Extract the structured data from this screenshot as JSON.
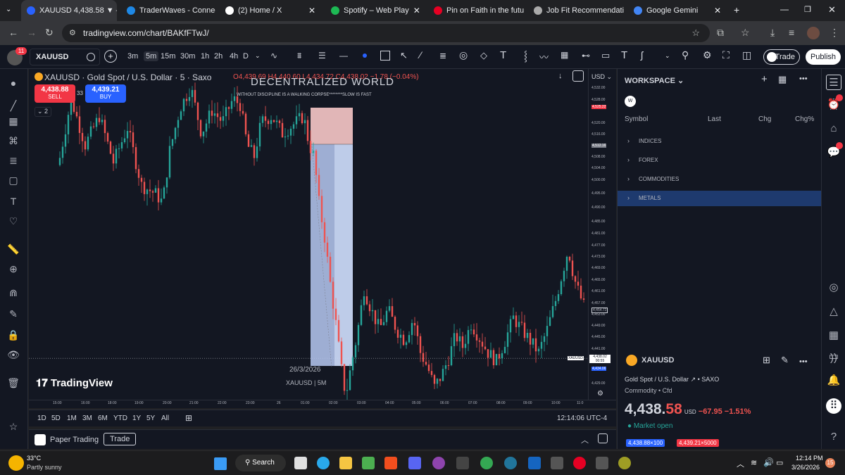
{
  "browser": {
    "tabs": [
      {
        "label": "XAUUSD 4,438.58 ▼ –",
        "icon_color": "#2962ff",
        "active": true
      },
      {
        "label": "TraderWaves - Connec",
        "icon_color": "#1e88e5",
        "active": false
      },
      {
        "label": "(2) Home / X",
        "icon_color": "#ffffff",
        "active": false
      },
      {
        "label": "Spotify – Web Play",
        "icon_color": "#1db954",
        "active": false
      },
      {
        "label": "Pin on Faith in the futu",
        "icon_color": "#e60023",
        "active": false
      },
      {
        "label": "Job Fit Recommendati",
        "icon_color": "#aaaaaa",
        "active": false
      },
      {
        "label": "Google Gemini",
        "icon_color": "#4285f4",
        "active": false
      }
    ],
    "url": "tradingview.com/chart/BAKfFTwJ/"
  },
  "toolbar": {
    "symbol": "XAUUSD",
    "timeframes": [
      "3m",
      "5m",
      "15m",
      "30m",
      "1h",
      "2h",
      "4h",
      "D"
    ],
    "selected_timeframe": "5m",
    "trade_label": "Trade",
    "publish_label": "Publish",
    "alert_badge": "11"
  },
  "chart": {
    "title": "XAUUSD · Gold Spot / U.S. Dollar · 5 · Saxo",
    "ohlc": "O4,439.69 H4,440.60 L4,434.72 C4,438.02 −1.78 (−0.04%)",
    "sell_price": "4,438.88",
    "sell_label": "SELL",
    "buy_price": "4,439.21",
    "buy_label": "BUY",
    "spread": "33",
    "indicator_count": "2",
    "watermark_title": "DECENTRALIZED WORLD",
    "watermark_sub": "WITHOUT DISCIPLINE IS A WALKING CORPSE********SLOW IS FAST",
    "date_stamp": "26/3/2026",
    "symbol_stamp": "XAUUSD | 5M",
    "brand": "TradingView",
    "currency": "USD",
    "price_labels": [
      "4,532.00",
      "4,528.00",
      "4,525.22",
      "4,520.00",
      "4,516.00",
      "4,512.16",
      "4,508.00",
      "4,504.00",
      "4,500.00",
      "4,495.00",
      "4,490.00",
      "4,485.00",
      "4,481.00",
      "4,477.00",
      "4,473.00",
      "4,469.00",
      "4,465.00",
      "4,461.00",
      "4,457.00",
      "4,454.72",
      "4,453.00",
      "4,449.00",
      "4,445.00",
      "4,441.00",
      "4,438.02",
      "4,434.06",
      "4,429.00"
    ],
    "current_price_tag": "4,438.02",
    "current_countdown": "00:55",
    "current_symbol_tag": "XAUUSD",
    "time_labels": [
      "15:00",
      "16:00",
      "18:00",
      "19:00",
      "20:00",
      "21:00",
      "22:00",
      "23:00",
      "26",
      "01:00",
      "02:00",
      "03:00",
      "04:00",
      "05:00",
      "06:00",
      "07:00",
      "08:00",
      "09:00",
      "10:00",
      "11:0"
    ],
    "ranges": [
      "1D",
      "5D",
      "1M",
      "3M",
      "6M",
      "YTD",
      "1Y",
      "5Y",
      "All"
    ],
    "clock": "12:14:06 UTC-4",
    "paper_trading": "Paper Trading",
    "trade_tab": "Trade"
  },
  "watchlist": {
    "workspace": "WORKSPACE",
    "avatar": "W",
    "columns": [
      "Symbol",
      "Last",
      "Chg",
      "Chg%"
    ],
    "groups": [
      "INDICES",
      "FOREX",
      "COMMODITIES",
      "METALS"
    ],
    "selected_group": "METALS"
  },
  "details": {
    "symbol": "XAUUSD",
    "name": "Gold Spot / U.S. Dollar",
    "exchange": "SAXO",
    "type": "Commodity",
    "subtype": "Cfd",
    "price_main": "4,438.",
    "price_small": "58",
    "currency": "USD",
    "change": "−67.95",
    "change_pct": "−1.51%",
    "market_status": "Market open",
    "bid": "4,438.88×100",
    "ask": "4,439.21×5000"
  },
  "taskbar": {
    "weather_temp": "33°C",
    "weather_desc": "Partly sunny",
    "search": "Search",
    "time": "12:14 PM",
    "date": "3/26/2026",
    "notif_count": "15"
  },
  "colors": {
    "up": "#26a69a",
    "down": "#ef5350",
    "accent": "#2962ff",
    "bg": "#131722"
  }
}
